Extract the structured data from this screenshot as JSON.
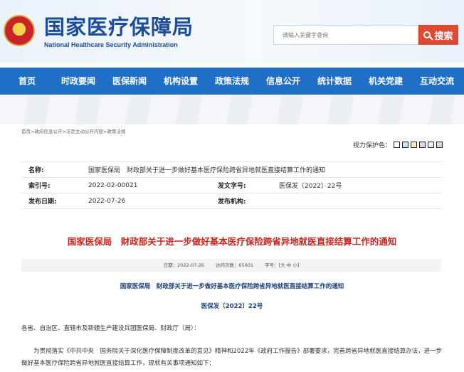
{
  "header": {
    "title": "国家医疗保障局",
    "subtitle": "National Healthcare Security Administration",
    "emblem_icon": "national-emblem",
    "search": {
      "placeholder": "请输入关键字查询",
      "button_label": "搜索",
      "button_color": "#dd4a32"
    }
  },
  "nav": {
    "color": "#1f6fc7",
    "items": [
      "首页",
      "时政要闻",
      "医保新闻",
      "机构设置",
      "政策法规",
      "信息公开",
      "统计数据",
      "机关党建",
      "互动交流"
    ]
  },
  "breadcrumb": [
    "首页",
    "政府信息公开",
    "法定主动公开内容",
    "政策法规"
  ],
  "breadcrumb_sep": ">",
  "vision": {
    "label": "视力保护色：",
    "swatches": [
      "#ffffff",
      "#c7e3f7",
      "#f5e7c8",
      "#e3d4ee",
      "#f1f1f1",
      "#d9d9d9"
    ]
  },
  "meta": {
    "name_label": "名称:",
    "name_value": "国家医保局　财政部关于进一步做好基本医疗保险跨省异地就医直接结算工作的通知",
    "index_label": "索引号:",
    "index_value": "2022-02-00021",
    "docno_label": "发文字号:",
    "docno_value": "医保发〔2022〕22号",
    "date_label": "发布日期:",
    "date_value": "2022-07-26",
    "org_label": "发布机构:",
    "org_value": ""
  },
  "article": {
    "title": "国家医保局　财政部关于进一步做好基本医疗保险跨省异地就医直接结算工作的通知",
    "info_date": "日期：2022-07-26",
    "info_views": "访问次数：65601",
    "info_font_label": "字号：[",
    "font_large": "大",
    "font_medium": "中",
    "font_small": "小",
    "info_font_end": "]",
    "subtitle": "国家医保局　财政部关于进一步做好基本医疗保险跨省异地就医直接结算工作的通知",
    "docno": "医保发〔2022〕22号",
    "salutation": "各省、自治区、直辖市及新疆生产建设兵团医保局、财政厅（局）：",
    "para1": "为贯彻落实《中共中央　国务院关于深化医疗保障制度改革的意见》精神和2022年《政府工作报告》部署要求，完善跨省异地就医直接结算办法，进一步做好基本医疗保险跨省异地就医直接结算工作，现就有关事项通知如下："
  },
  "colors": {
    "title_red": "#c8261c",
    "brand_blue": "#1b4c9c"
  }
}
